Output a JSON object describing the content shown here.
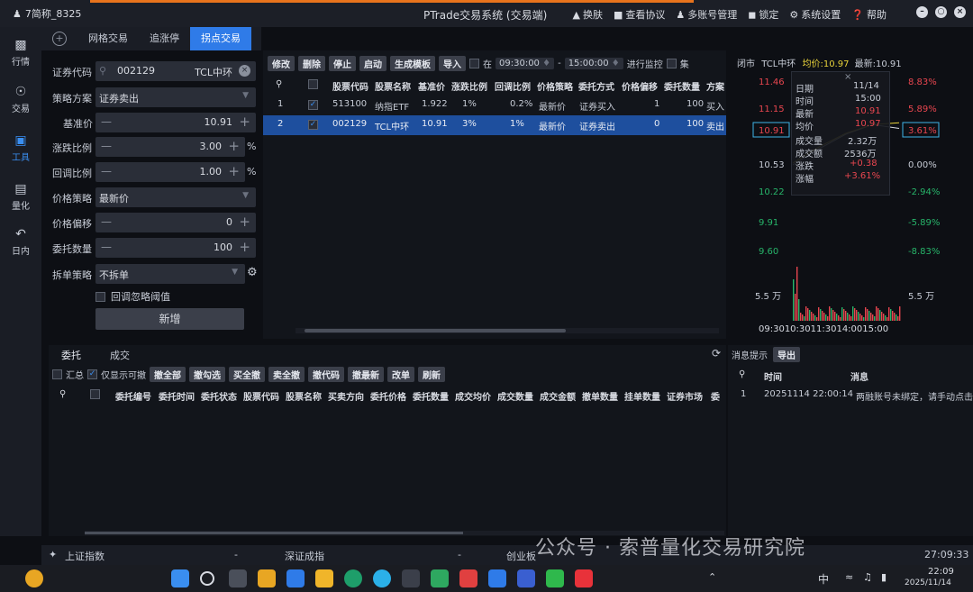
{
  "titlebar": {
    "user": "7简称_8325",
    "app_title": "PTrade交易系统 (交易端)",
    "menu": [
      {
        "icon": "shirt-icon",
        "label": "换肤"
      },
      {
        "icon": "doc-icon",
        "label": "查看协议"
      },
      {
        "icon": "users-icon",
        "label": "多账号管理"
      },
      {
        "icon": "lock-icon",
        "label": "锁定"
      },
      {
        "icon": "gear-icon",
        "label": "系统设置"
      },
      {
        "icon": "help-icon",
        "label": "帮助"
      }
    ]
  },
  "leftnav": [
    {
      "icon": "chart-icon",
      "label": "行情"
    },
    {
      "icon": "trade-icon",
      "label": "交易"
    },
    {
      "icon": "toolbox-icon",
      "label": "工具"
    },
    {
      "icon": "quant-icon",
      "label": "量化"
    },
    {
      "icon": "intraday-icon",
      "label": "日内"
    }
  ],
  "tabs": [
    "网格交易",
    "追涨停",
    "拐点交易"
  ],
  "form": {
    "code_label": "证券代码",
    "code_value": "002129",
    "code_name": "TCL中环",
    "strategy_label": "策略方案",
    "strategy_value": "证券卖出",
    "base_label": "基准价",
    "base_value": "10.91",
    "rise_label": "涨跌比例",
    "rise_value": "3.00",
    "retrace_label": "回调比例",
    "retrace_value": "1.00",
    "pct": "%",
    "price_strategy_label": "价格策略",
    "price_strategy_value": "最新价",
    "price_offset_label": "价格偏移",
    "price_offset_value": "0",
    "qty_label": "委托数量",
    "qty_value": "100",
    "split_label": "拆单策略",
    "split_value": "不拆单",
    "ignore_label": "回调忽略阈值",
    "add_label": "新增"
  },
  "toolbar": {
    "buttons": [
      "修改",
      "删除",
      "停止",
      "启动",
      "生成模板",
      "导入"
    ],
    "at": "在",
    "start_time": "09:30:00",
    "dash": "-",
    "end_time": "15:00:00",
    "monitor": "进行监控",
    "collect": "集"
  },
  "grid": {
    "headers": [
      "股票代码",
      "股票名称",
      "基准价",
      "涨跌比例",
      "回调比例",
      "价格策略",
      "委托方式",
      "价格偏移",
      "委托数量",
      "方案"
    ],
    "rows": [
      [
        "1",
        "513100",
        "纳指ETF",
        "1.922",
        "1%",
        "0.2%",
        "最新价",
        "证券买入",
        "1",
        "100",
        "买入"
      ],
      [
        "2",
        "002129",
        "TCL中环",
        "10.91",
        "3%",
        "1%",
        "最新价",
        "证券卖出",
        "0",
        "100",
        "卖出"
      ]
    ]
  },
  "chart": {
    "status": "闭市",
    "name": "TCL中环",
    "avg_label": "均价",
    "avg_value": "10.97",
    "last_label": "最新",
    "last_value": "10.91",
    "left_ticks": [
      "11.46",
      "11.15",
      "10.91",
      "10.53",
      "10.22",
      "9.91",
      "9.60",
      "5.5 万"
    ],
    "right_ticks": [
      "8.83%",
      "5.89%",
      "3.61%",
      "0.00%",
      "-2.94%",
      "-5.89%",
      "-8.83%",
      "5.5 万"
    ],
    "time_axis": "09:3010:3011:3014:0015:00",
    "popup": {
      "date_label": "日期",
      "date_value": "11/14",
      "time_label": "时间",
      "time_value": "15:00",
      "last_label": "最新",
      "last_value": "10.91",
      "avg_label": "均价",
      "avg_value": "10.97",
      "vol_label": "成交量",
      "vol_value": "2.32万",
      "amt_label": "成交额",
      "amt_value": "2536万",
      "chg_label": "涨跌",
      "chg_value": "+0.38",
      "pct_label": "涨幅",
      "pct_value": "+3.61%"
    }
  },
  "chart_data": {
    "type": "line",
    "title": "",
    "x": [
      "09:30",
      "10:30",
      "11:30/13:00",
      "14:00",
      "15:00"
    ],
    "series": [
      {
        "name": "最新",
        "values": [
          10.53,
          10.7,
          10.85,
          10.95,
          10.91
        ]
      },
      {
        "name": "均价",
        "values": [
          10.55,
          10.72,
          10.86,
          10.95,
          10.97
        ]
      }
    ],
    "ylim": [
      9.6,
      11.46
    ]
  },
  "orders": {
    "tabs": [
      "委托",
      "成交"
    ],
    "summary": "汇总",
    "only_cancel": "仅显示可撤",
    "buttons": [
      "撤全部",
      "撤勾选",
      "买全撤",
      "卖全撤",
      "撤代码",
      "撤最新",
      "改单",
      "刷新"
    ],
    "headers": [
      "委托编号",
      "委托时间",
      "委托状态",
      "股票代码",
      "股票名称",
      "买卖方向",
      "委托价格",
      "委托数量",
      "成交均价",
      "成交数量",
      "成交金额",
      "撤单数量",
      "挂单数量",
      "证券市场",
      "委"
    ]
  },
  "messages": {
    "title": "消息提示",
    "export": "导出",
    "col_time": "时间",
    "col_msg": "消息",
    "rows": [
      [
        "1",
        "20251114 22:00:14",
        "两融账号未绑定，请手动点击"
      ]
    ]
  },
  "statusbar": {
    "sh": "上证指数",
    "sh_val": "-",
    "sz": "深证成指",
    "sz_val": "-",
    "cy": "创业板",
    "time": "27:09:33"
  },
  "watermark": "公众号 · 索普量化交易研究院",
  "taskbar": {
    "ime": "中",
    "time": "22:09",
    "date": "2025/11/14"
  }
}
